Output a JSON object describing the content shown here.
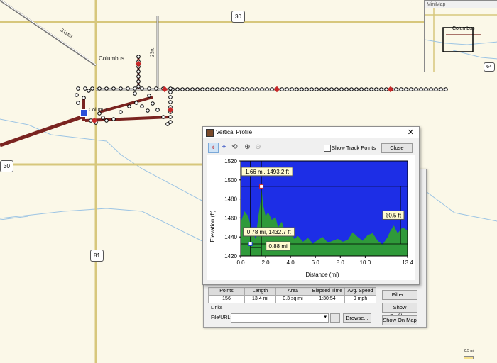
{
  "map": {
    "shields": {
      "hwy30_top": "30",
      "hwy30_left": "30",
      "hwy81": "81",
      "hwy64": "64"
    },
    "labels": {
      "columbus": "Columbus",
      "colum1": "Colum 1",
      "street_diag": "31stst",
      "street_23rd": "23rd"
    },
    "scale": {
      "label": "0.5 mi"
    }
  },
  "minimap": {
    "title": "MiniMap",
    "label": "Columbus",
    "shield": "64"
  },
  "track_stats": {
    "headers": [
      "Points",
      "Length",
      "Area",
      "Elapsed Time",
      "Avg. Speed"
    ],
    "values": [
      "156",
      "13.4 mi",
      "0.3 sq mi",
      "1:30:54",
      "9 mph"
    ]
  },
  "back_dialog": {
    "filter_button": "Filter...",
    "show_profile_button": "Show Profile...",
    "show_on_map_button": "Show On Map",
    "links_label": "Links",
    "file_url_label": "File/URL:",
    "browse_button": "Browse..."
  },
  "vertical_profile": {
    "title": "Vertical Profile",
    "show_track_points_label": "Show Track Points",
    "close_button": "Close",
    "toolbar_icons": [
      "crosshair-red-icon",
      "crosshair-blue-icon",
      "lasso-zoom-icon",
      "zoom-in-icon",
      "zoom-out-icon"
    ]
  },
  "chart_data": {
    "type": "area",
    "xlabel": "Distance  (mi)",
    "ylabel": "Elevation (ft)",
    "xlim": [
      0,
      13.4
    ],
    "ylim": [
      1420,
      1520
    ],
    "xticks": [
      "0.0",
      "2.0",
      "4.0",
      "6.0",
      "8.0",
      "10.0",
      "13.4"
    ],
    "yticks": [
      "1520",
      "1500",
      "1480",
      "1460",
      "1440",
      "1420"
    ],
    "grid": false,
    "colors": {
      "background": "#1d2ee6",
      "area": "#2f9a3a"
    },
    "x": [
      0,
      0.3,
      0.6,
      0.8,
      1.0,
      1.2,
      1.4,
      1.6,
      1.66,
      1.8,
      2.0,
      2.2,
      2.5,
      2.8,
      3.0,
      3.3,
      3.6,
      4.0,
      4.3,
      4.6,
      5.0,
      5.4,
      5.8,
      6.2,
      6.6,
      7.0,
      7.4,
      7.8,
      8.2,
      8.6,
      9.0,
      9.4,
      9.8,
      10.2,
      10.6,
      11.0,
      11.4,
      11.8,
      12.0,
      12.3,
      12.6,
      13.0,
      13.4
    ],
    "y": [
      1455,
      1467,
      1462,
      1452,
      1445,
      1438,
      1460,
      1478,
      1493,
      1474,
      1462,
      1466,
      1458,
      1461,
      1450,
      1456,
      1444,
      1447,
      1438,
      1441,
      1435,
      1439,
      1433,
      1437,
      1440,
      1434,
      1436,
      1438,
      1435,
      1437,
      1445,
      1440,
      1436,
      1442,
      1444,
      1436,
      1432,
      1440,
      1446,
      1452,
      1444,
      1450,
      1447
    ],
    "annotations": [
      {
        "text": "1.66 mi, 1493.2 ft",
        "x": 1.66,
        "y": 1493.2
      },
      {
        "text": "0.78 mi, 1432.7 ft",
        "x": 0.78,
        "y": 1432.7
      },
      {
        "text": "0.88 mi",
        "x": 0.88
      },
      {
        "text": "60.5 ft",
        "y": 1462.95
      }
    ]
  }
}
